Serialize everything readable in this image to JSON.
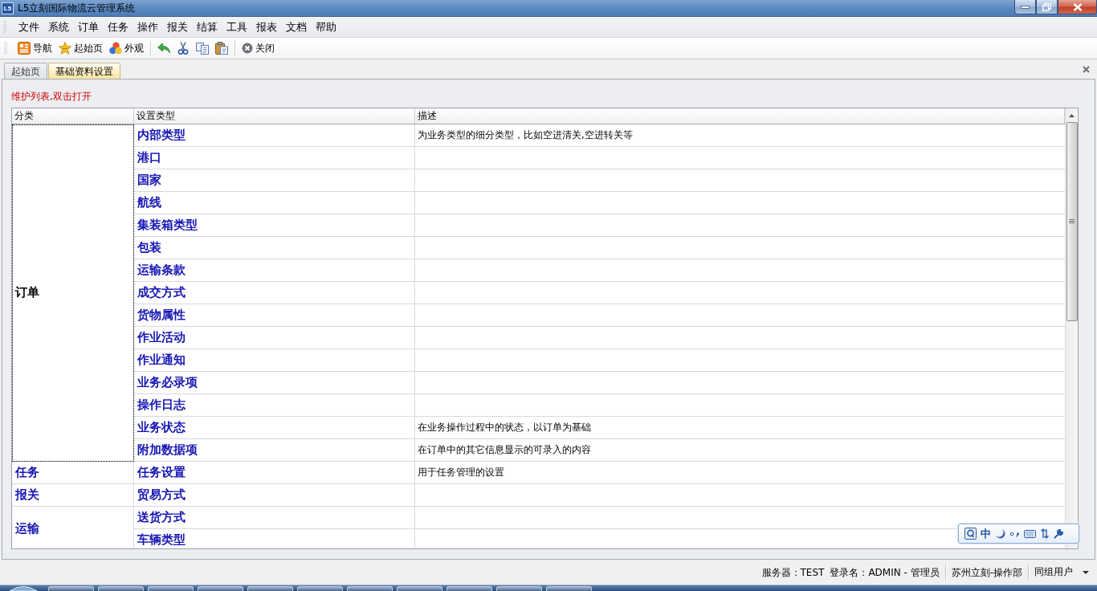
{
  "window": {
    "logo": "L5",
    "title": "L5立刻国际物流云管理系统"
  },
  "menu": [
    "文件",
    "系统",
    "订单",
    "任务",
    "操作",
    "报关",
    "结算",
    "工具",
    "报表",
    "文档",
    "帮助"
  ],
  "toolbar": {
    "nav_buttons": [
      "导航",
      "起始页",
      "外观"
    ],
    "close_button": "关闭"
  },
  "tabs": [
    {
      "label": "起始页",
      "selected": false
    },
    {
      "label": "基础资料设置",
      "selected": true
    }
  ],
  "panel": {
    "hint": "维护列表,双击打开"
  },
  "table": {
    "columns": [
      "分类",
      "设置类型",
      "描述"
    ],
    "groups": [
      {
        "category": "订单",
        "focused": true,
        "rows": [
          {
            "type": "内部类型",
            "description": "为业务类型的细分类型，比如空进清关,空进转关等"
          },
          {
            "type": "港口"
          },
          {
            "type": "国家"
          },
          {
            "type": "航线"
          },
          {
            "type": "集装箱类型"
          },
          {
            "type": "包装"
          },
          {
            "type": "运输条款"
          },
          {
            "type": "成交方式"
          },
          {
            "type": "货物属性"
          },
          {
            "type": "作业活动"
          },
          {
            "type": "作业通知"
          },
          {
            "type": "业务必录项"
          },
          {
            "type": "操作日志"
          },
          {
            "type": "业务状态",
            "description": "在业务操作过程中的状态，以订单为基础"
          },
          {
            "type": "附加数据项",
            "description": "在订单中的其它信息显示的可录入的内容"
          }
        ]
      },
      {
        "category": "任务",
        "focused": false,
        "rows": [
          {
            "type": "任务设置",
            "description": "用于任务管理的设置"
          }
        ]
      },
      {
        "category": "报关",
        "focused": false,
        "rows": [
          {
            "type": "贸易方式"
          }
        ]
      },
      {
        "category": "运输",
        "focused": false,
        "rows": [
          {
            "type": "送货方式"
          },
          {
            "type": "车辆类型"
          }
        ]
      }
    ]
  },
  "ime_bar": {
    "mode": "中"
  },
  "status_bar": {
    "server_label": "服务器：",
    "server": "TEST",
    "login_label": "登录名：",
    "login": "ADMIN - 管理员",
    "department": "苏州立刻-操作部",
    "group_users": "同组用户"
  }
}
